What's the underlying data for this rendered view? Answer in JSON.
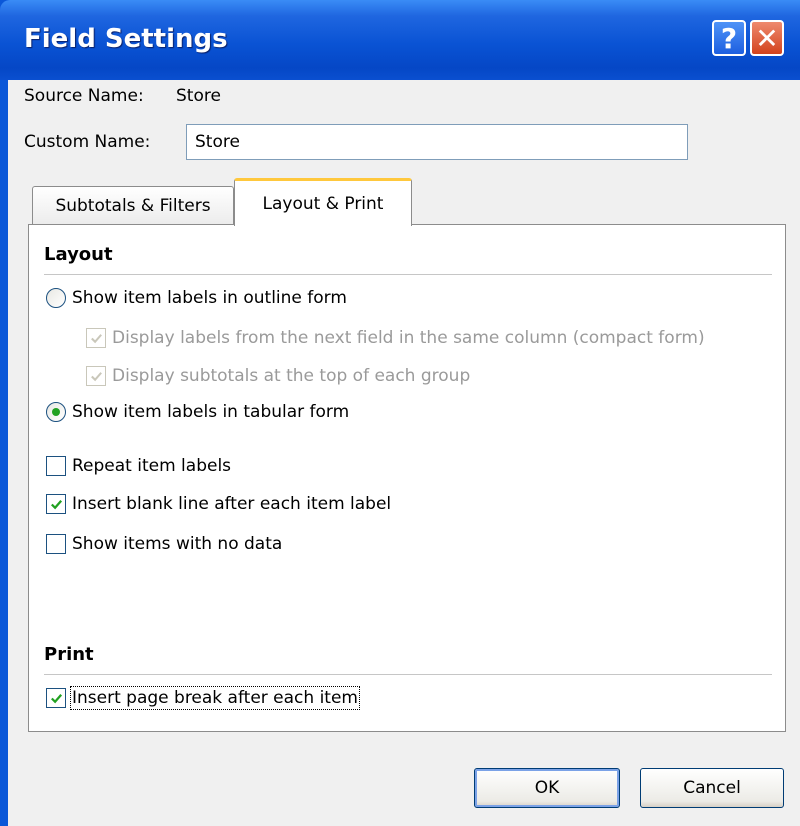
{
  "window": {
    "title": "Field Settings",
    "help_glyph": "?",
    "close_glyph": "✕"
  },
  "source": {
    "label": "Source Name:",
    "value": "Store"
  },
  "custom": {
    "label": "Custom Name:",
    "value": "Store"
  },
  "tabs": [
    {
      "label": "Subtotals & Filters",
      "active": false
    },
    {
      "label": "Layout & Print",
      "active": true
    }
  ],
  "layout": {
    "heading": "Layout",
    "outline_label": "Show item labels in outline form",
    "compact_label": "Display labels from the next field in the same column (compact form)",
    "subtotals_top_label": "Display subtotals at the top of each group",
    "tabular_label": "Show item labels in tabular form",
    "repeat_label": "Repeat item labels",
    "blank_line_label": "Insert blank line after each item label",
    "no_data_label": "Show items with no data",
    "selected_form": "tabular",
    "checks": {
      "compact": true,
      "subtotals_top": true,
      "repeat": false,
      "blank_line": true,
      "no_data": false
    }
  },
  "print": {
    "heading": "Print",
    "page_break_label": "Insert page break after each item",
    "page_break_checked": true
  },
  "buttons": {
    "ok": "OK",
    "cancel": "Cancel"
  },
  "colors": {
    "titlebar": "#0a53d4",
    "check": "#21a121",
    "tab_highlight": "#ffc83d"
  }
}
